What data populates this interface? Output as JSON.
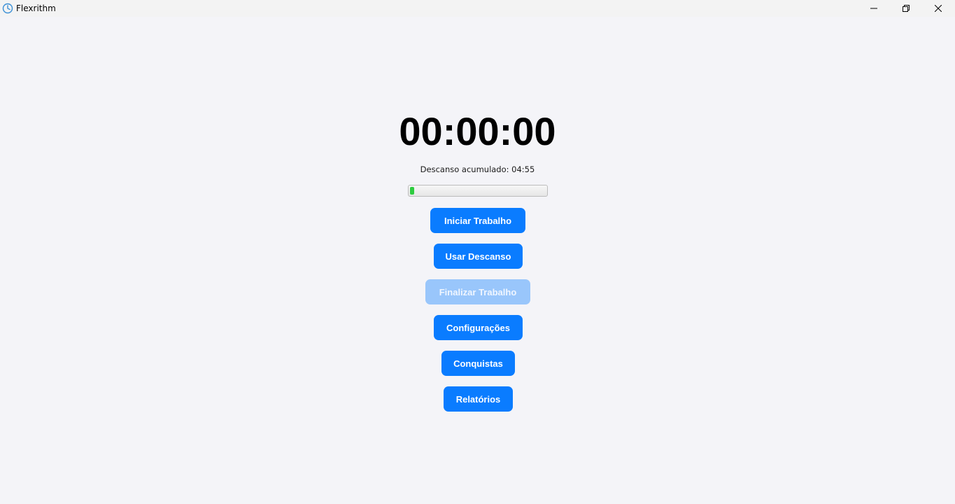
{
  "window": {
    "title": "Flexrithm",
    "app_icon": "clock-icon",
    "controls": {
      "minimize_icon": "minimize-icon",
      "maximize_icon": "restore-icon",
      "close_icon": "close-icon"
    }
  },
  "timer": {
    "display": "00:00:00"
  },
  "rest": {
    "label": "Descanso acumulado: 04:55",
    "progress_fraction": 0.03,
    "progress_color": "#2ecc40"
  },
  "actions": [
    {
      "label": "Iniciar Trabalho",
      "enabled": true
    },
    {
      "label": "Usar Descanso",
      "enabled": true
    },
    {
      "label": "Finalizar Trabalho",
      "enabled": false
    },
    {
      "label": "Configurações",
      "enabled": true
    },
    {
      "label": "Conquistas",
      "enabled": true
    },
    {
      "label": "Relatórios",
      "enabled": true
    }
  ],
  "colors": {
    "accent": "#0a7cff",
    "accent_disabled": "#99c6fb",
    "background": "#f4f4f8"
  }
}
